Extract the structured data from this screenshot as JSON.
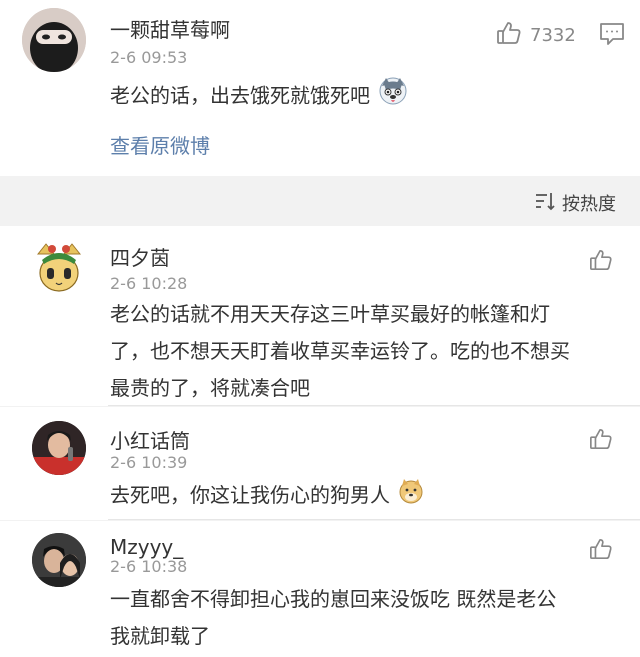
{
  "main_post": {
    "username": "一颗甜草莓啊",
    "time": "2-6 09:53",
    "text": "老公的话，出去饿死就饿死吧",
    "likes": "7332",
    "view_original": "查看原微博",
    "like_icon": "thumbs-up-icon",
    "comment_icon": "comment-icon",
    "emoji": "husky-emoji"
  },
  "sort": {
    "label": "按热度",
    "icon": "sort-icon"
  },
  "comments": [
    {
      "username": "四夕茵",
      "time": "2-6 10:28",
      "lines": [
        "老公的话就不用天天存这三叶草买最好的帐篷和灯",
        "了，也不想天天盯着收草买幸运铃了。吃的也不想买",
        "最贵的了，将就凑合吧"
      ]
    },
    {
      "username": "小红话筒",
      "time": "2-6 10:39",
      "lines": [
        "去死吧，你这让我伤心的狗男人"
      ],
      "emoji": "doge-emoji"
    },
    {
      "username": "Mzyyy_",
      "time": "2-6 10:38",
      "lines": [
        "一直都舍不得卸担心我的崽回来没饭吃 既然是老公",
        "我就卸载了"
      ]
    }
  ]
}
